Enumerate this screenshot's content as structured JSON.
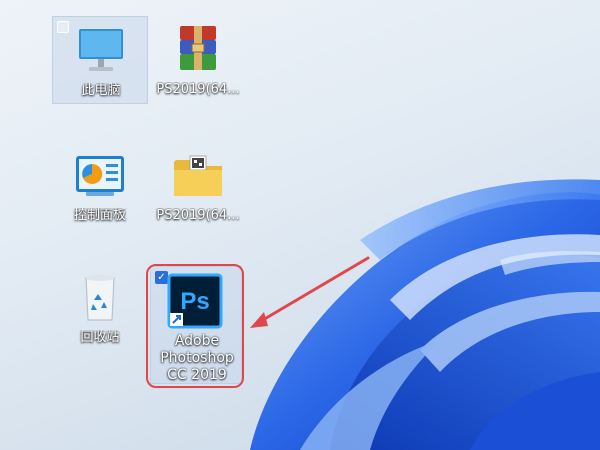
{
  "desktop": {
    "icons": [
      {
        "label": "此电脑",
        "icon": "computer-icon"
      },
      {
        "label": "PS2019(64...",
        "icon": "winrar-archive-icon"
      },
      {
        "label": "控制面板",
        "icon": "control-panel-icon"
      },
      {
        "label": "PS2019(64...",
        "icon": "folder-icon"
      },
      {
        "label": "回收站",
        "icon": "recycle-bin-icon"
      },
      {
        "label": "Adobe Photoshop CC 2019",
        "icon": "photoshop-icon"
      }
    ],
    "ps_tile_text": "Ps",
    "colors": {
      "highlight": "#e0474b",
      "ps_blue": "#31a8ff",
      "ps_bg": "#001e36",
      "wallpaper_blue": "#1f5fe0"
    }
  }
}
